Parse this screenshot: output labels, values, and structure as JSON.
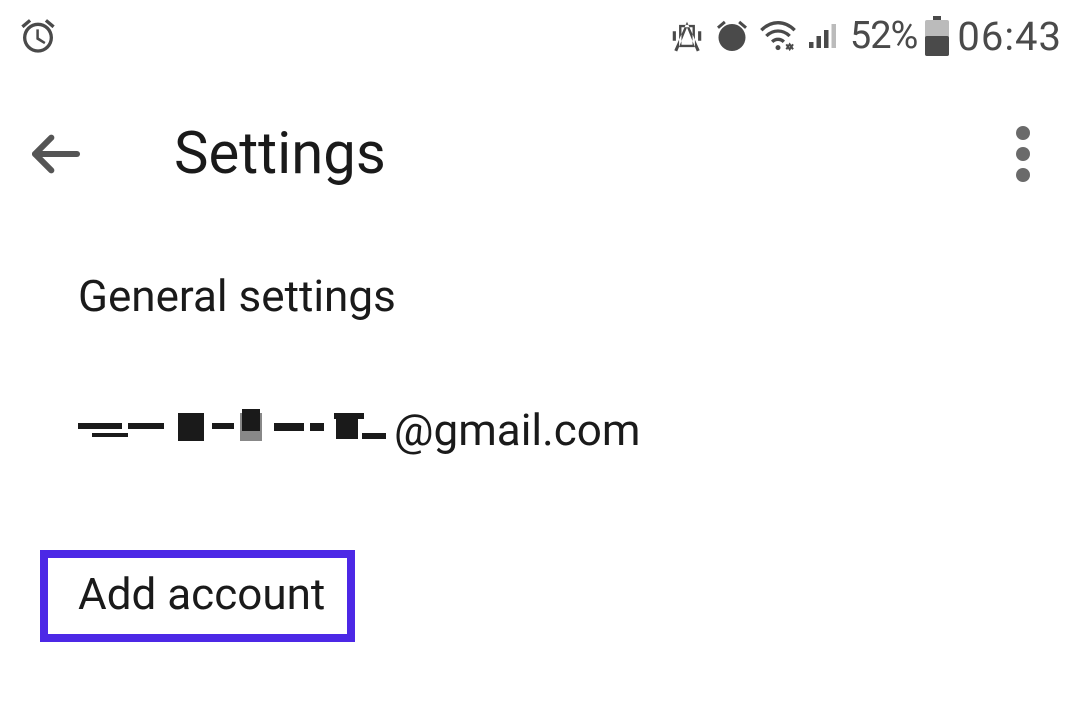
{
  "status": {
    "battery_pct": "52%",
    "clock": "06:43"
  },
  "header": {
    "title": "Settings"
  },
  "list": {
    "general": "General settings",
    "email_suffix": "@gmail.com",
    "add_account": "Add account"
  }
}
